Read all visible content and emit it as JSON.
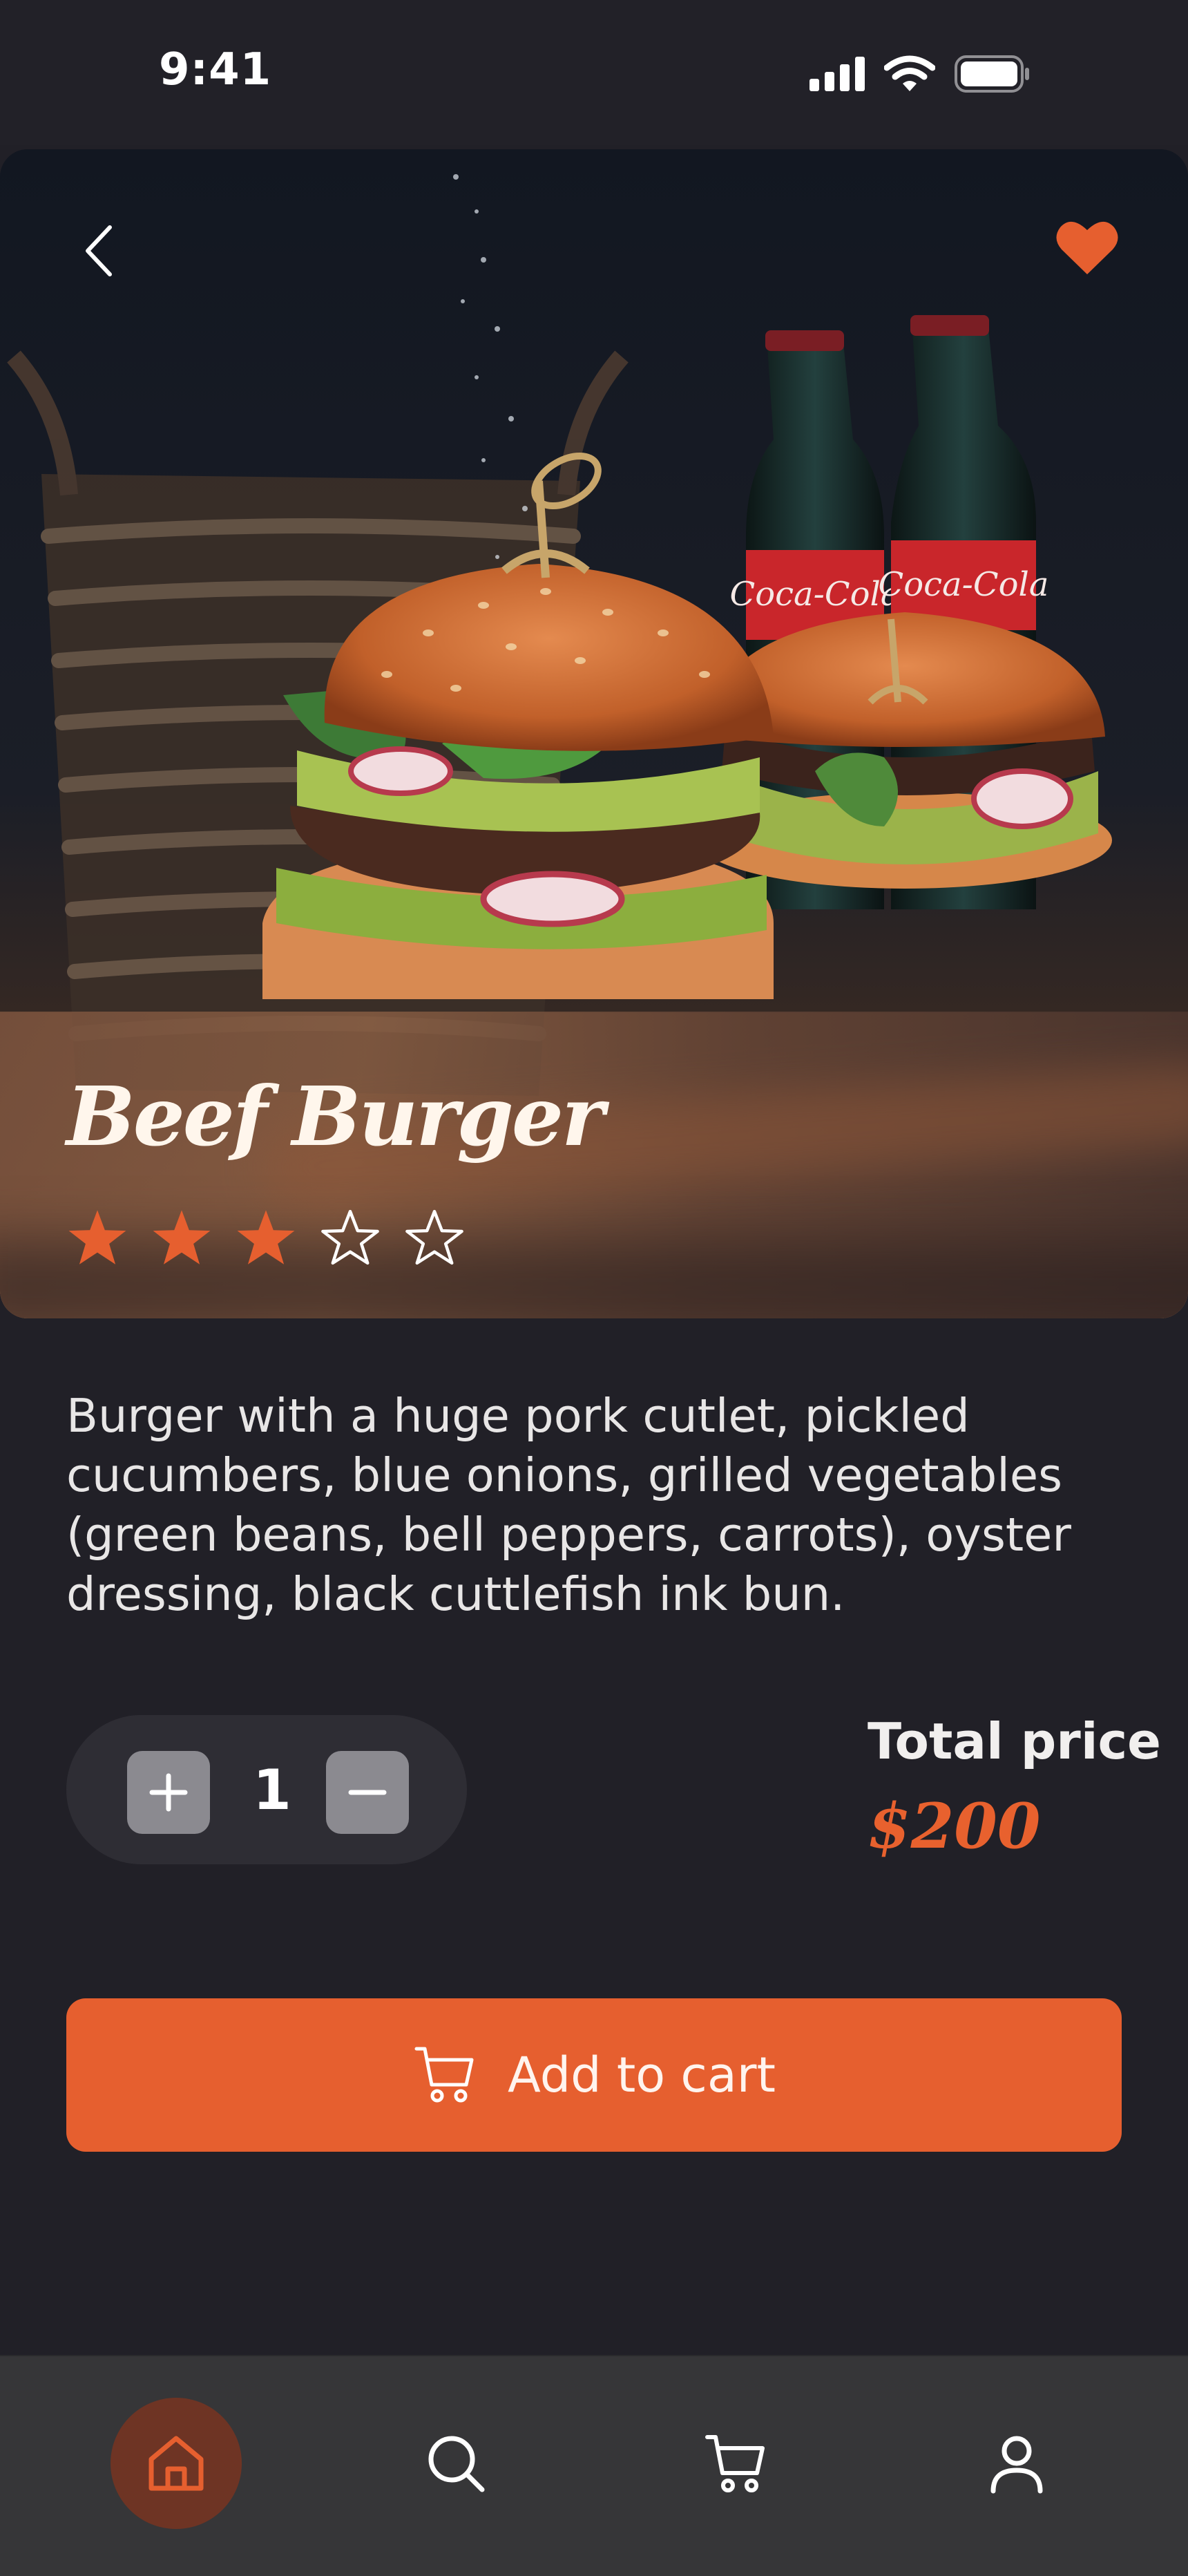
{
  "status_bar": {
    "time": "9:41",
    "icons": [
      "signal-icon",
      "wifi-icon",
      "battery-icon"
    ]
  },
  "product": {
    "title": "Beef Burger",
    "rating": 3,
    "rating_max": 5,
    "description": "Burger with a huge pork cutlet, pickled cucumbers, blue onions, grilled vegetables (green beans, bell peppers, carrots), oyster dressing, black cuttlefish ink bun.",
    "is_favorite": true,
    "bottle_label": "Coca-Cola"
  },
  "quantity": {
    "value": "1",
    "increment_icon": "plus-icon",
    "decrement_icon": "minus-icon"
  },
  "price": {
    "label": "Total price",
    "value": "$200"
  },
  "cart_button": {
    "label": "Add to cart",
    "icon": "cart-icon"
  },
  "nav": {
    "items": [
      {
        "name": "home",
        "icon": "home-icon",
        "active": true
      },
      {
        "name": "search",
        "icon": "search-icon",
        "active": false
      },
      {
        "name": "cart",
        "icon": "cart-icon",
        "active": false
      },
      {
        "name": "profile",
        "icon": "user-icon",
        "active": false
      }
    ]
  },
  "colors": {
    "accent": "#E65F2F",
    "background": "#212027",
    "nav_background": "#363638",
    "active_nav": "#6E3424"
  }
}
